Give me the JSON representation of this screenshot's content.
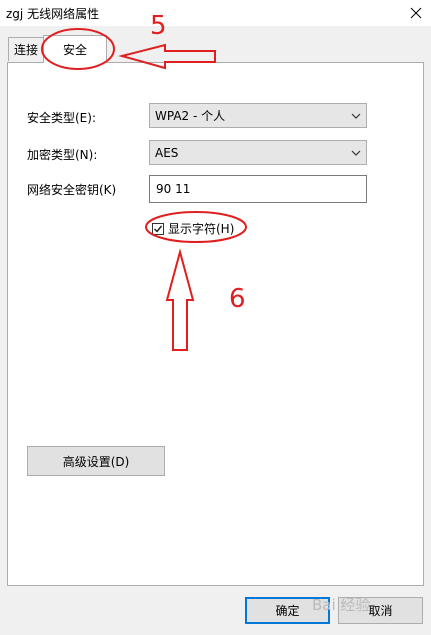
{
  "window": {
    "title": "zgj 无线网络属性"
  },
  "tabs": [
    {
      "label": "连接",
      "active": false
    },
    {
      "label": "安全",
      "active": true
    }
  ],
  "form": {
    "security_type_label": "安全类型(E):",
    "security_type_value": "WPA2 - 个人",
    "encryption_type_label": "加密类型(N):",
    "encryption_type_value": "AES",
    "key_label": "网络安全密钥(K)",
    "key_value": "90⁠⁠⁠⁠   11",
    "show_chars_label": "显示字符(H)",
    "show_chars_checked": true
  },
  "buttons": {
    "advanced": "高级设置(D)",
    "ok": "确定",
    "cancel": "取消"
  },
  "annotations": {
    "step5": "5",
    "step6": "6",
    "color": "#e02020"
  },
  "watermark": "Bai 经验"
}
